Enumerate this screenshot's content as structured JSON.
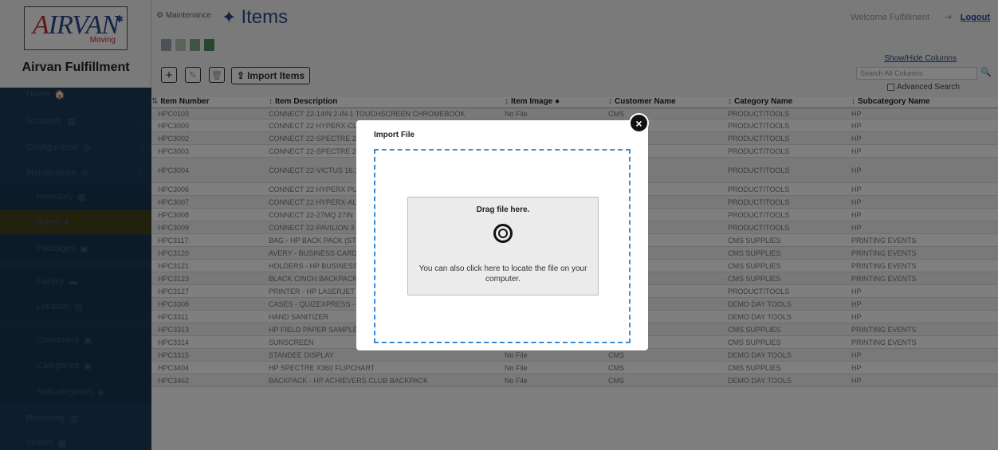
{
  "brand": {
    "logo_text_a": "A",
    "logo_text_rest": "IRVAN",
    "logo_sub": "Moving",
    "app_name": "Airvan Fulfillment"
  },
  "header": {
    "breadcrumb": "Maintenance",
    "title": "Items",
    "welcome": "Welcome Fulfillment",
    "logout": "Logout"
  },
  "sidebar": {
    "items": [
      {
        "label": "Home",
        "icon": "home-icon",
        "glyph": "🏠"
      },
      {
        "label": "Accounts",
        "icon": "accounts-icon",
        "glyph": "▦"
      },
      {
        "label": "Configuration",
        "icon": "gears-icon",
        "glyph": "⚙"
      },
      {
        "label": "Maintenance",
        "icon": "gears-icon",
        "glyph": "⚙"
      },
      {
        "label": "Inventory",
        "icon": "inventory-icon",
        "glyph": "▦"
      },
      {
        "label": "Items",
        "icon": "puzzle-icon",
        "glyph": "✦"
      },
      {
        "label": "Packages",
        "icon": "package-icon",
        "glyph": "▣"
      },
      {
        "label": "Facility",
        "icon": "facility-icon",
        "glyph": "▬"
      },
      {
        "label": "Location",
        "icon": "location-icon",
        "glyph": "▤"
      },
      {
        "label": "Customers",
        "icon": "customers-icon",
        "glyph": "▣"
      },
      {
        "label": "Categories",
        "icon": "categories-icon",
        "glyph": "◉"
      },
      {
        "label": "Subcategories",
        "icon": "subcategories-icon",
        "glyph": "◈"
      },
      {
        "label": "Receiving",
        "icon": "receiving-icon",
        "glyph": "▥"
      },
      {
        "label": "Orders",
        "icon": "orders-icon",
        "glyph": "▦"
      }
    ]
  },
  "toolbar": {
    "add": "+",
    "edit": "✎",
    "delete": "🗑",
    "import_label": "Import Items",
    "show_hide": "Show/Hide Columns",
    "search_placeholder": "Search All Columns",
    "advanced": "Advanced Search"
  },
  "table": {
    "columns": [
      "Item Number",
      "Item Description",
      "Item Image",
      "Customer Name",
      "Category Name",
      "Subcategory Name"
    ],
    "rows": [
      [
        "HPC0103",
        "CONNECT 22-14IN 2-IN-1 TOUCHSCREEN CHROMEBOOK",
        "No File",
        "CMS",
        "PRODUCT/TOOLS",
        "HP"
      ],
      [
        "HPC3000",
        "CONNECT 22 HYPERX-CLOUD",
        "",
        "",
        "PRODUCT/TOOLS",
        "HP"
      ],
      [
        "HPC3002",
        "CONNECT 22-SPECTRE 2-IN-1",
        "",
        "",
        "PRODUCT/TOOLS",
        "HP"
      ],
      [
        "HPC3003",
        "CONNECT 22-SPECTRE 2-IN-1",
        "",
        "",
        "PRODUCT/TOOLS",
        "HP"
      ],
      [
        "HPC3004",
        "CONNECT 22-VICTUS 16.1",
        "",
        "",
        "PRODUCT/TOOLS",
        "HP"
      ],
      [
        "HPC3006",
        "CONNECT 22 HYPERX PULSEFIRE",
        "",
        "",
        "PRODUCT/TOOLS",
        "HP"
      ],
      [
        "HPC3007",
        "CONNECT 22 HYPERX-ALLOY",
        "",
        "",
        "PRODUCT/TOOLS",
        "HP"
      ],
      [
        "HPC3008",
        "CONNECT 22-27MQ 27IN",
        "",
        "",
        "PRODUCT/TOOLS",
        "HP"
      ],
      [
        "HPC3009",
        "CONNECT 22-PAVILION 3",
        "",
        "",
        "PRODUCT/TOOLS",
        "HP"
      ],
      [
        "HPC3117",
        "BAG - HP BACK PACK (STEALTH",
        "",
        "",
        "CMS SUPPLIES",
        "PRINTING EVENTS"
      ],
      [
        "HPC3120",
        "AVERY - BUSINESS CARD",
        "",
        "",
        "CMS SUPPLIES",
        "PRINTING EVENTS"
      ],
      [
        "HPC3121",
        "HOLDERS - HP BUSINESS",
        "",
        "",
        "CMS SUPPLIES",
        "PRINTING EVENTS"
      ],
      [
        "HPC3123",
        "BLACK CINCH BACKPACK",
        "",
        "",
        "CMS SUPPLIES",
        "PRINTING EVENTS"
      ],
      [
        "HPC3127",
        "PRINTER - HP LASERJET M",
        "",
        "",
        "PRODUCT/TOOLS",
        "HP"
      ],
      [
        "HPC3308",
        "CASES - QUIZEXPRESS - 5",
        "",
        "",
        "DEMO DAY TOOLS",
        "HP"
      ],
      [
        "HPC3311",
        "HAND SANITIZER",
        "No File",
        "CMS",
        "DEMO DAY TOOLS",
        "HP"
      ],
      [
        "HPC3313",
        "HP FIELD PAPER SAMPLE KIT",
        "No File",
        "CMS",
        "CMS SUPPLIES",
        "PRINTING EVENTS"
      ],
      [
        "HPC3314",
        "SUNSCREEN",
        "No File",
        "CMS",
        "CMS SUPPLIES",
        "PRINTING EVENTS"
      ],
      [
        "HPC3315",
        "STANDEE DISPLAY",
        "No File",
        "CMS",
        "DEMO DAY TOOLS",
        "HP"
      ],
      [
        "HPC3404",
        "HP SPECTRE X360 FLIPCHART",
        "No File",
        "CMS",
        "CMS SUPPLIES",
        "HP"
      ],
      [
        "HPC3462",
        "BACKPACK - HP ACHIEVERS CLUB BACKPACK",
        "No File",
        "CMS",
        "DEMO DAY TOOLS",
        "HP"
      ]
    ]
  },
  "modal": {
    "title": "Import File",
    "close": "×",
    "drag_text": "Drag file here.",
    "hint": "You can also click here to locate the file on your computer."
  },
  "colors": {
    "sidebar": "#1d3a57",
    "accent": "#2b4a8c",
    "dropzone_border": "#3a8bd6"
  }
}
